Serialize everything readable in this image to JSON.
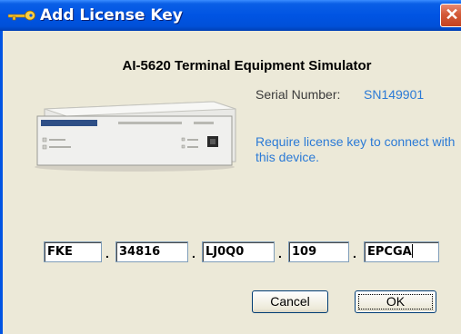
{
  "window": {
    "title": "Add License Key",
    "close_symbol": "✕",
    "title_icon": "key-icon"
  },
  "device": {
    "model_heading": "AI-5620  Terminal Equipment Simulator",
    "serial_label": "Serial Number:",
    "serial_value": "SN149901",
    "notice": "Require license key to connect with this device."
  },
  "license_key": {
    "segments": [
      "FKE",
      "34816",
      "LJ0Q0",
      "109",
      "EPCGA"
    ],
    "separator": "."
  },
  "buttons": {
    "cancel_label": "Cancel",
    "ok_label": "OK"
  },
  "colors": {
    "title_bar": "#0054E3",
    "close_button": "#D35A38",
    "link_text": "#2B7AD6",
    "dialog_background": "#ECE9D8"
  }
}
